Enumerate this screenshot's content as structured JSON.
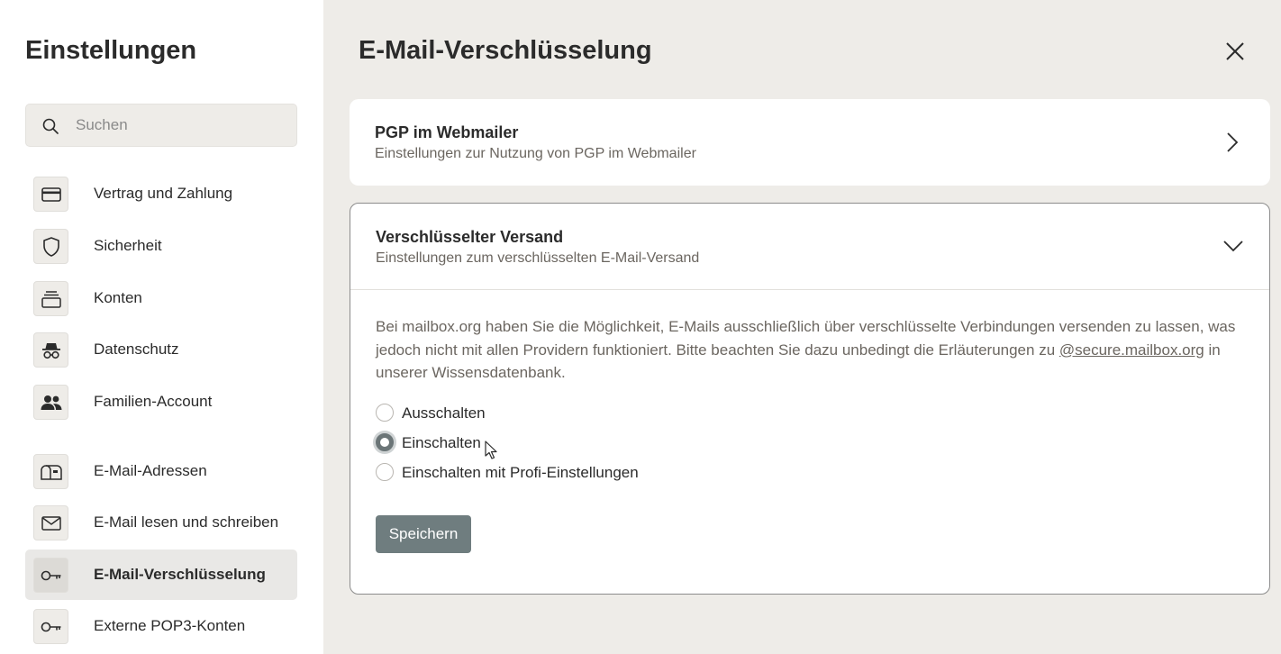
{
  "sidebar": {
    "title": "Einstellungen",
    "search_placeholder": "Suchen",
    "items": [
      {
        "label": "Vertrag und Zahlung",
        "icon": "credit-card-icon"
      },
      {
        "label": "Sicherheit",
        "icon": "shield-icon"
      },
      {
        "label": "Konten",
        "icon": "stack-icon"
      },
      {
        "label": "Datenschutz",
        "icon": "incognito-icon"
      },
      {
        "label": "Familien-Account",
        "icon": "people-icon"
      },
      {
        "label": "E-Mail-Adressen",
        "icon": "mailbox-icon"
      },
      {
        "label": "E-Mail lesen und schreiben",
        "icon": "envelope-icon"
      },
      {
        "label": "E-Mail-Verschlüsselung",
        "icon": "key-icon",
        "active": true
      },
      {
        "label": "Externe POP3-Konten",
        "icon": "key-icon"
      }
    ]
  },
  "main": {
    "title": "E-Mail-Verschlüsselung",
    "cards": [
      {
        "title": "PGP im Webmailer",
        "subtitle": "Einstellungen zur Nutzung von PGP im Webmailer",
        "expanded": false
      },
      {
        "title": "Verschlüsselter Versand",
        "subtitle": "Einstellungen zum verschlüsselten E-Mail-Versand",
        "expanded": true,
        "description_before": "Bei mailbox.org haben Sie die Möglichkeit, E-Mails ausschließlich über verschlüsselte Verbindungen versenden zu lassen, was jedoch nicht mit allen Providern funktioniert. Bitte beachten Sie dazu unbedingt die Erläuterungen zu ",
        "description_link": "@secure.mailbox.org",
        "description_after": " in unserer Wissensdatenbank.",
        "options": [
          "Ausschalten",
          "Einschalten",
          "Einschalten mit Profi-Einstellungen"
        ],
        "selected_option": "Einschalten",
        "save_label": "Speichern"
      }
    ]
  },
  "colors": {
    "background": "#eeece8",
    "sidebar": "#ffffff",
    "save_button": "#6f7d7f",
    "muted_text": "#6b6660"
  }
}
